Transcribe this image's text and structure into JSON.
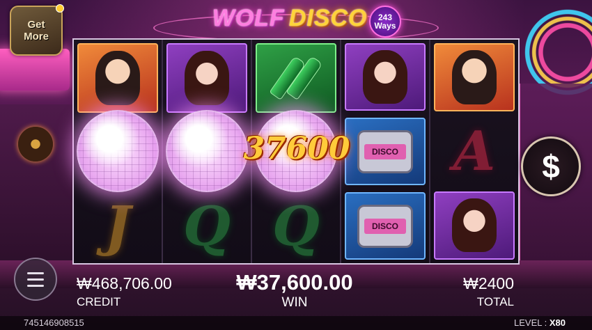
{
  "game": {
    "logo_word1": "WOLF",
    "logo_word2": "DISCO",
    "ways_number": "243",
    "ways_label": "Ways"
  },
  "get_more": {
    "line1": "Get",
    "line2": "More"
  },
  "reels": [
    [
      "man",
      "disco-ball",
      "letter-J"
    ],
    [
      "woman",
      "disco-ball",
      "letter-Q"
    ],
    [
      "bottles",
      "disco-ball",
      "letter-Q"
    ],
    [
      "woman",
      "pager",
      "pager"
    ],
    [
      "man",
      "letter-A",
      "woman"
    ]
  ],
  "symbols": {
    "pager_screen": "DISCO",
    "letter_j": "J",
    "letter_q": "Q",
    "letter_a": "A"
  },
  "win_overlay": "37600",
  "spin_symbol": "$",
  "stats": {
    "credit_value": "₩468,706.00",
    "credit_label": "CREDIT",
    "win_value": "₩37,600.00",
    "win_label": "WIN",
    "total_value": "₩2400",
    "total_label": "TOTAL"
  },
  "footer": {
    "session_id": "745146908515",
    "level_label": "LEVEL : ",
    "level_value": "X80"
  }
}
